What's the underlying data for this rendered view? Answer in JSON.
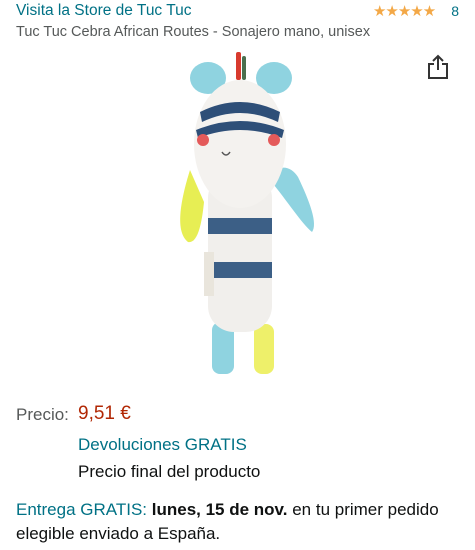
{
  "header": {
    "store_link": "Visita la Store de Tuc Tuc",
    "rating_count": "8",
    "stars": 5
  },
  "product": {
    "title": "Tuc Tuc Cebra African Routes - Sonajero mano, unisex",
    "image_icon": "zebra-rattle-toy",
    "share_icon": "share-icon"
  },
  "pricing": {
    "label": "Precio:",
    "value": "9,51 €",
    "returns": "Devoluciones GRATIS",
    "final_note": "Precio final del producto"
  },
  "delivery": {
    "free_label": "Entrega GRATIS:",
    "date": "lunes, 15 de nov.",
    "rest": "en tu primer pedido elegible enviado a España."
  },
  "colors": {
    "link": "#007185",
    "price": "#b12704",
    "star": "#f3a847"
  }
}
